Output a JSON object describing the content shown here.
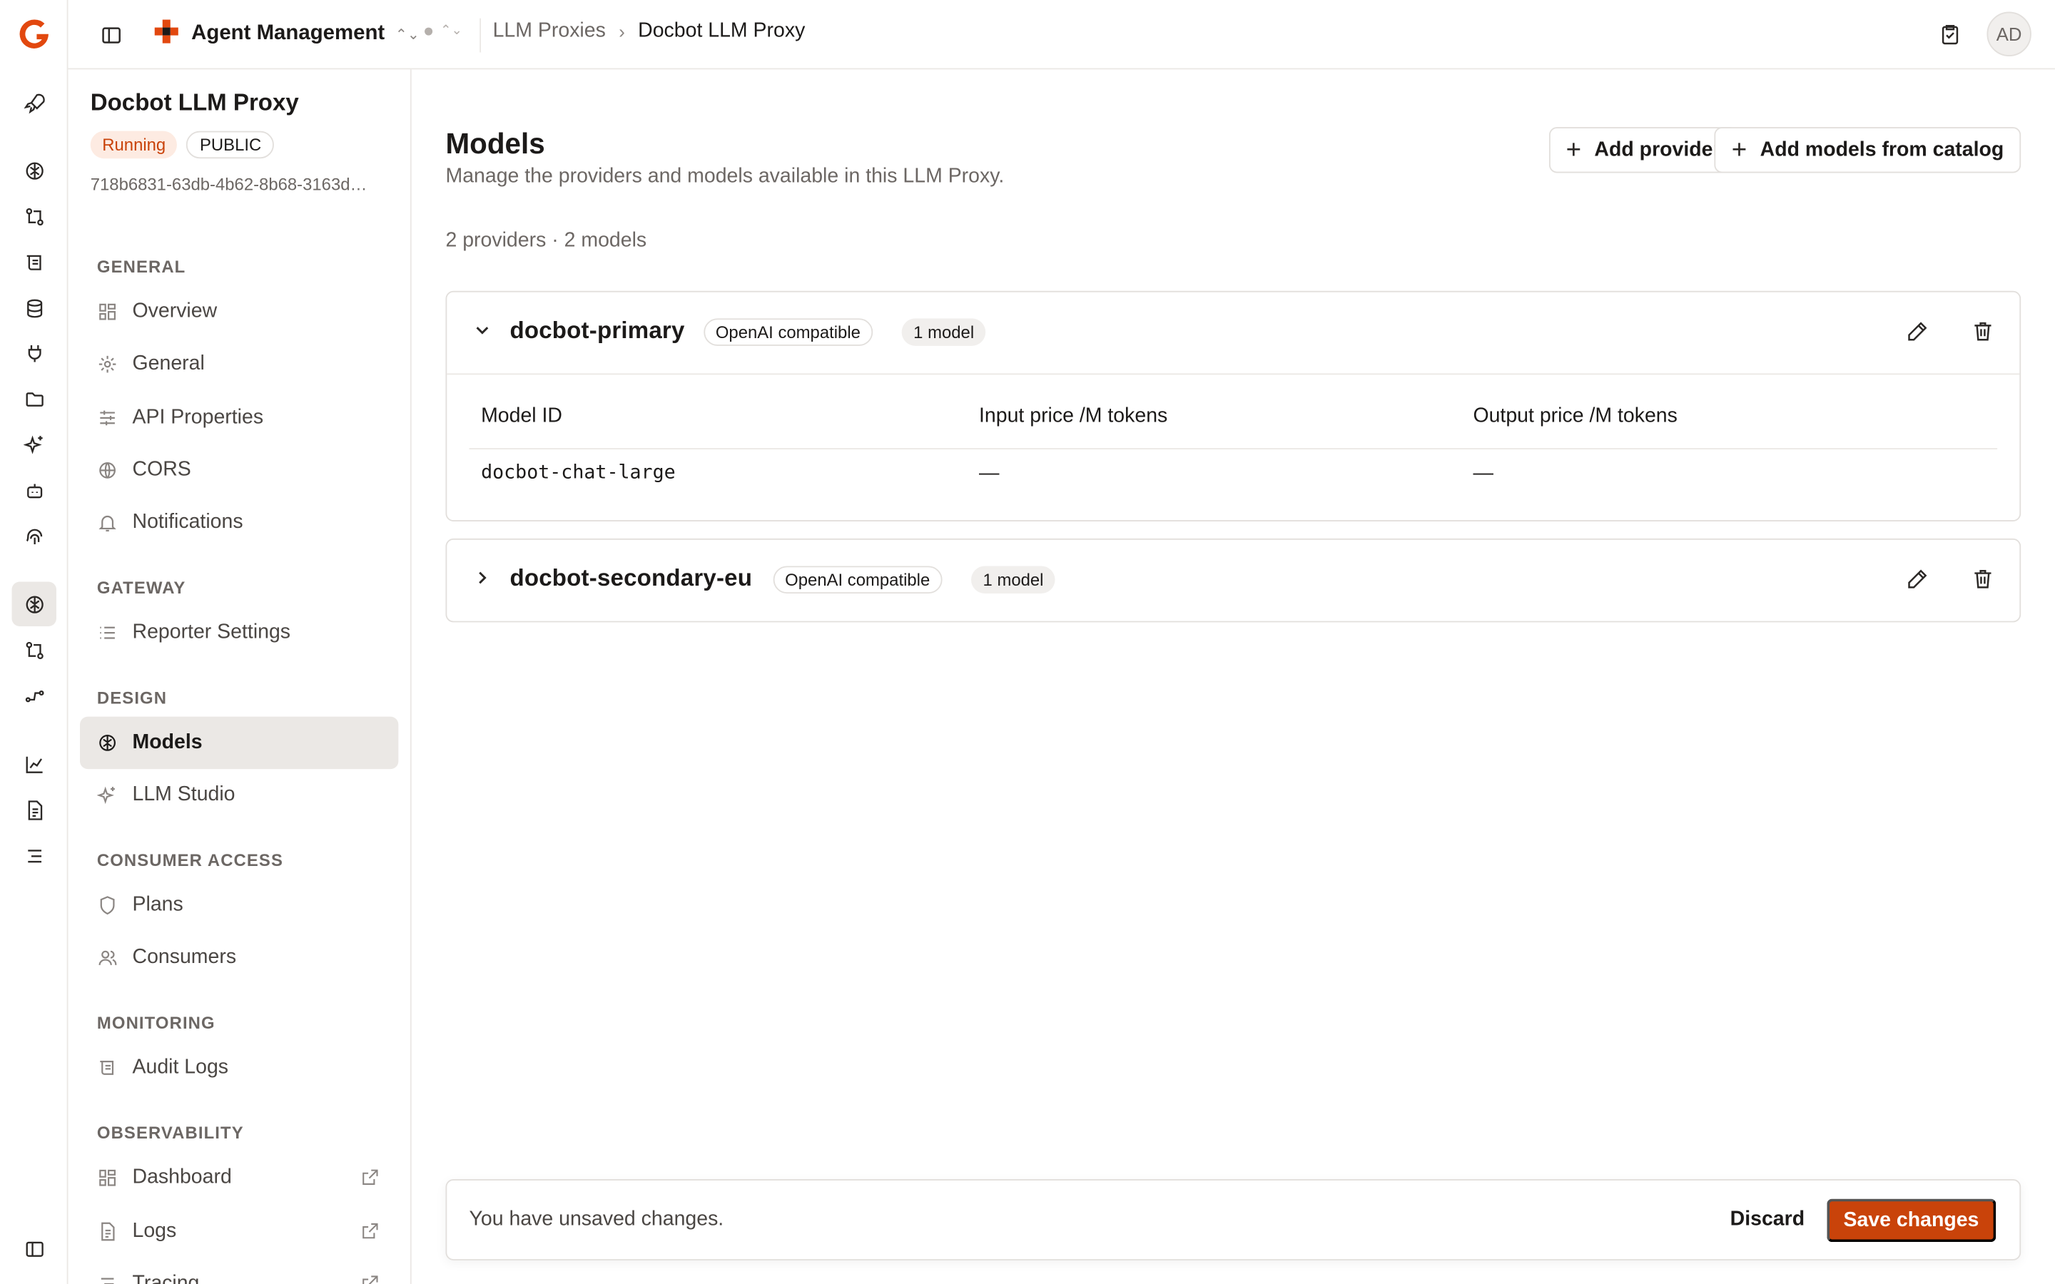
{
  "topbar": {
    "org_name": "Agent Management",
    "breadcrumbs": [
      "LLM Proxies",
      "Docbot LLM Proxy"
    ],
    "avatar_initials": "AD"
  },
  "sidebar": {
    "title": "Docbot LLM Proxy",
    "status": "Running",
    "visibility": "PUBLIC",
    "id": "718b6831-63db-4b62-8b68-3163d…",
    "sections": [
      {
        "label": "GENERAL",
        "items": [
          "Overview",
          "General",
          "API Properties",
          "CORS",
          "Notifications"
        ]
      },
      {
        "label": "GATEWAY",
        "items": [
          "Reporter Settings"
        ]
      },
      {
        "label": "DESIGN",
        "items": [
          "Models",
          "LLM Studio"
        ]
      },
      {
        "label": "CONSUMER ACCESS",
        "items": [
          "Plans",
          "Consumers"
        ]
      },
      {
        "label": "MONITORING",
        "items": [
          "Audit Logs"
        ]
      },
      {
        "label": "OBSERVABILITY",
        "items": [
          "Dashboard",
          "Logs",
          "Tracing"
        ]
      }
    ],
    "active_item": "Models"
  },
  "main": {
    "title": "Models",
    "subtitle": "Manage the providers and models available in this LLM Proxy.",
    "add_provider": "Add provider",
    "add_catalog": "Add models from catalog",
    "summary": "2 providers · 2 models",
    "providers": [
      {
        "name": "docbot-primary",
        "type": "OpenAI compatible",
        "model_count": "1 model",
        "expanded": true,
        "columns": [
          "Model ID",
          "Input price /M tokens",
          "Output price /M tokens"
        ],
        "rows": [
          [
            "docbot-chat-large",
            "—",
            "—"
          ]
        ]
      },
      {
        "name": "docbot-secondary-eu",
        "type": "OpenAI compatible",
        "model_count": "1 model",
        "expanded": false
      }
    ],
    "unsaved": {
      "message": "You have unsaved changes.",
      "discard": "Discard",
      "save": "Save changes"
    }
  },
  "colors": {
    "accent": "#c9430a",
    "running_bg": "#fdebe2",
    "active_nav_bg": "#ebe8e5"
  }
}
